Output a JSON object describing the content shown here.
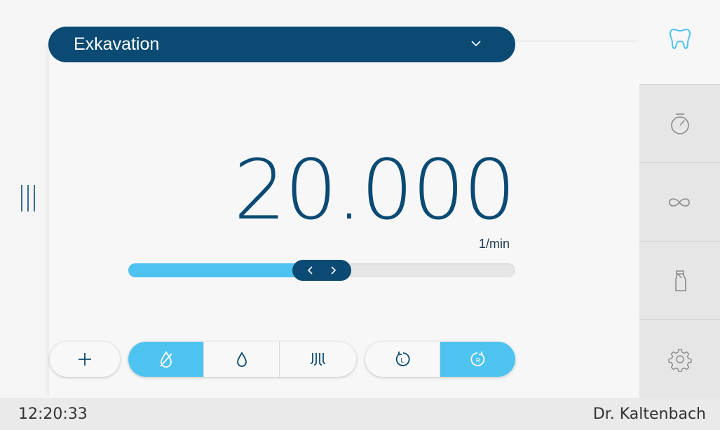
{
  "program": {
    "label": "Exkavation",
    "icon": "chevron-down-icon"
  },
  "speed": {
    "value": "20.000",
    "unit": "1/min",
    "slider_fraction": 0.5
  },
  "toolbar": {
    "add_icon": "plus-icon",
    "coolant": [
      {
        "icon": "no-water-icon",
        "active": true
      },
      {
        "icon": "water-drop-icon",
        "active": false
      },
      {
        "icon": "spray-icon",
        "active": false
      }
    ],
    "direction": [
      {
        "icon": "rotate-left-icon",
        "label": "L",
        "active": false
      },
      {
        "icon": "rotate-right-icon",
        "label": "R",
        "active": true
      }
    ]
  },
  "sidebar": {
    "tabs": [
      {
        "icon": "tooth-icon",
        "active": true
      },
      {
        "icon": "stopwatch-icon",
        "active": false
      },
      {
        "icon": "infinity-icon",
        "active": false
      },
      {
        "icon": "spray-bottle-icon",
        "active": false
      },
      {
        "icon": "gear-icon",
        "active": false
      }
    ]
  },
  "status": {
    "time": "12:20:33",
    "user": "Dr. Kaltenbach"
  },
  "colors": {
    "navy": "#0a4a73",
    "accent": "#4fc3f0",
    "icon_gray": "#8a8a8a"
  }
}
